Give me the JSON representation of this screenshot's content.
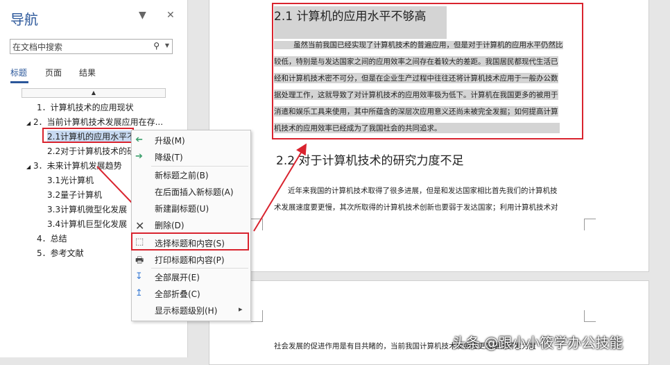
{
  "nav": {
    "title": "导航",
    "dropdown_glyph": "▼",
    "close_glyph": "✕",
    "search_placeholder": "在文档中搜索",
    "search_glyph": "⚲",
    "tabs": [
      "标题",
      "页面",
      "结果"
    ],
    "tree": [
      "1．计算机技术的应用现状",
      "2．当前计算机技术发展应用在存...",
      "2.1计算机的应用水平不",
      "2.2对于计算机技术的研",
      "3．未来计算机发展趋势",
      "3.1光计算机",
      "3.2量子计算机",
      "3.3计算机微型化发展",
      "3.4计算机巨型化发展",
      "4．总结",
      "5．参考文献"
    ]
  },
  "menu": {
    "items": [
      {
        "label": "升级(M)",
        "icon": "arrow-left-icon",
        "glyph": "➔",
        "color": "#3a9e6b"
      },
      {
        "label": "降级(T)",
        "icon": "arrow-right-icon",
        "glyph": "➔",
        "color": "#3a9e6b"
      },
      {
        "label": "新标题之前(B)"
      },
      {
        "label": "在后面插入新标题(A)"
      },
      {
        "label": "新建副标题(U)"
      },
      {
        "label": "删除(D)",
        "icon": "delete-icon",
        "glyph": "✕",
        "color": "#444444"
      },
      {
        "label": "选择标题和内容(S)",
        "icon": "select-icon",
        "glyph": "⬚",
        "color": "#555555"
      },
      {
        "label": "打印标题和内容(P)",
        "icon": "print-icon",
        "glyph": "🖶",
        "color": "#444444"
      },
      {
        "label": "全部展开(E)",
        "icon": "expand-icon",
        "glyph": "↧",
        "color": "#3a7bd5"
      },
      {
        "label": "全部折叠(C)",
        "icon": "collapse-icon",
        "glyph": "↥",
        "color": "#3a7bd5"
      },
      {
        "label": "显示标题级别(H)"
      }
    ],
    "submenu_arrow": "▸"
  },
  "document": {
    "heading1": "2.1 计算机的应用水平不够高",
    "para1": [
      "虽然当前我国已经实现了计算机技术的普遍应用，但是对于计算机的应用水平仍然比",
      "较低，特别是与发达国家之间的应用效率之间存在着较大的差距。我国居民都现代生活已",
      "经和计算机技术密不可分，但是在企业生产过程中往往还将计算机技术应用于一般办公数",
      "据处理工作，这就导致了对计算机技术的应用效率极为低下。计算机在我国更多的被用于",
      "消遣和娱乐工具来使用，其中所蕴含的深层次应用意义还尚未被完全发掘；如何提高计算",
      "机技术的应用效率已经成为了我国社会的共同追求。"
    ],
    "heading2": "2.2 对于计算机技术的研究力度不足",
    "para2": [
      "近年来我国的计算机技术取得了很多进展，但是和发达国家相比首先我们的计算机技",
      "术发展速度要更慢，其次所取得的计算机技术创新也要弱于发达国家；利用计算机技术对"
    ],
    "page2_line": "社会发展的促进作用是有目共睹的，当前我国计算机技术发展应更加重视研发力度"
  },
  "watermark": "头条 @跟小小筱学办公技能",
  "colors": {
    "accent": "#2b579a",
    "annotation_red": "#d9232e",
    "selection": "#c7d9f1"
  }
}
